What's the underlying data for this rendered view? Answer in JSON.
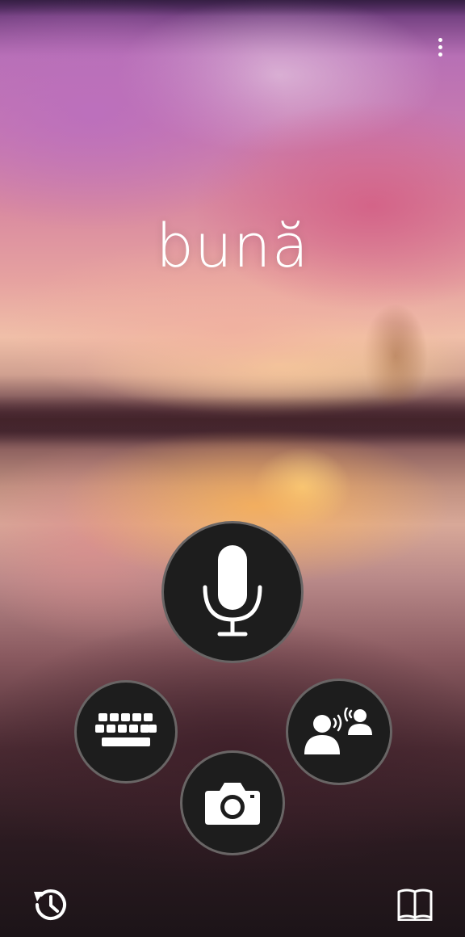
{
  "app": {
    "translated_phrase": "bună"
  },
  "controls": {
    "menu_icon": "more-vertical-icon",
    "mic_icon": "microphone-icon",
    "keyboard_icon": "keyboard-icon",
    "camera_icon": "camera-icon",
    "conversation_icon": "conversation-icon",
    "history_icon": "history-icon",
    "phrasebook_icon": "phrasebook-icon"
  },
  "colors": {
    "button_fill": "#1d1d1d",
    "icon": "#ffffff",
    "text": "#ffffff"
  }
}
